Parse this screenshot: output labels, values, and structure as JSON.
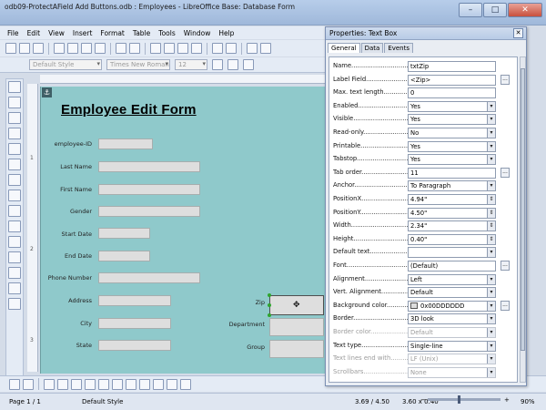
{
  "window": {
    "title": "odb09-ProtectAField Add Buttons.odb : Employees - LibreOffice Base: Database Form",
    "min": "–",
    "max": "□",
    "close": "✕"
  },
  "menu": [
    "File",
    "Edit",
    "View",
    "Insert",
    "Format",
    "Table",
    "Tools",
    "Window",
    "Help"
  ],
  "formatting": {
    "style": "Default Style",
    "font": "Times New Roman",
    "size": "12"
  },
  "form": {
    "title": "Employee Edit Form",
    "fields": [
      {
        "label": "employee-ID"
      },
      {
        "label": "Last Name"
      },
      {
        "label": "First Name"
      },
      {
        "label": "Gender"
      },
      {
        "label": "Start Date"
      },
      {
        "label": "End Date"
      },
      {
        "label": "Phone Number"
      },
      {
        "label": "Address"
      },
      {
        "label": "City"
      },
      {
        "label": "State"
      },
      {
        "label": "Zip"
      },
      {
        "label": "Department"
      },
      {
        "label": "Group"
      }
    ]
  },
  "vruler": [
    "1",
    "2",
    "3"
  ],
  "properties": {
    "title": "Properties: Text Box",
    "tabs": [
      "General",
      "Data",
      "Events"
    ],
    "rows": [
      {
        "label": "Name",
        "value": "txtZip",
        "kind": "txt"
      },
      {
        "label": "Label Field",
        "value": "<Zip>",
        "kind": "txt",
        "dots": true
      },
      {
        "label": "Max. text length",
        "value": "0",
        "kind": "txt"
      },
      {
        "label": "Enabled",
        "value": "Yes",
        "kind": "dd"
      },
      {
        "label": "Visible",
        "value": "Yes",
        "kind": "dd"
      },
      {
        "label": "Read-only",
        "value": "No",
        "kind": "dd"
      },
      {
        "label": "Printable",
        "value": "Yes",
        "kind": "dd"
      },
      {
        "label": "Tabstop",
        "value": "Yes",
        "kind": "dd"
      },
      {
        "label": "Tab order",
        "value": "11",
        "kind": "txt",
        "dots": true
      },
      {
        "label": "Anchor",
        "value": "To Paragraph",
        "kind": "dd"
      },
      {
        "label": "PositionX",
        "value": "4.94\"",
        "kind": "spin"
      },
      {
        "label": "PositionY",
        "value": "4.50\"",
        "kind": "spin"
      },
      {
        "label": "Width",
        "value": "2.34\"",
        "kind": "spin"
      },
      {
        "label": "Height",
        "value": "0.40\"",
        "kind": "spin"
      },
      {
        "label": "Default text",
        "value": "",
        "kind": "dd"
      },
      {
        "label": "Font",
        "value": "(Default)",
        "kind": "txt",
        "dots": true
      },
      {
        "label": "Alignment",
        "value": "Left",
        "kind": "dd"
      },
      {
        "label": "Vert. Alignment",
        "value": "Default",
        "kind": "dd"
      },
      {
        "label": "Background color",
        "value": "0x00DDDDDD",
        "kind": "dd",
        "swatch": true,
        "dots": true
      },
      {
        "label": "Border",
        "value": "3D look",
        "kind": "dd"
      },
      {
        "label": "Border color",
        "value": "Default",
        "kind": "dd",
        "disabled": true
      },
      {
        "label": "Text type",
        "value": "Single-line",
        "kind": "dd"
      },
      {
        "label": "Text lines end with",
        "value": "LF (Unix)",
        "kind": "dd",
        "disabled": true
      },
      {
        "label": "Scrollbars",
        "value": "None",
        "kind": "dd",
        "disabled": true
      }
    ]
  },
  "status": {
    "page": "Page 1 / 1",
    "style": "Default Style",
    "position": "3.69 / 4.50",
    "size": "3.60 x 0.40",
    "zoom": "90%",
    "zoom_minus": "−",
    "zoom_plus": "+"
  },
  "colors": {
    "canvas": "#8fc9cb",
    "field": "#dedede",
    "selection_handle": "#2fa52f"
  }
}
